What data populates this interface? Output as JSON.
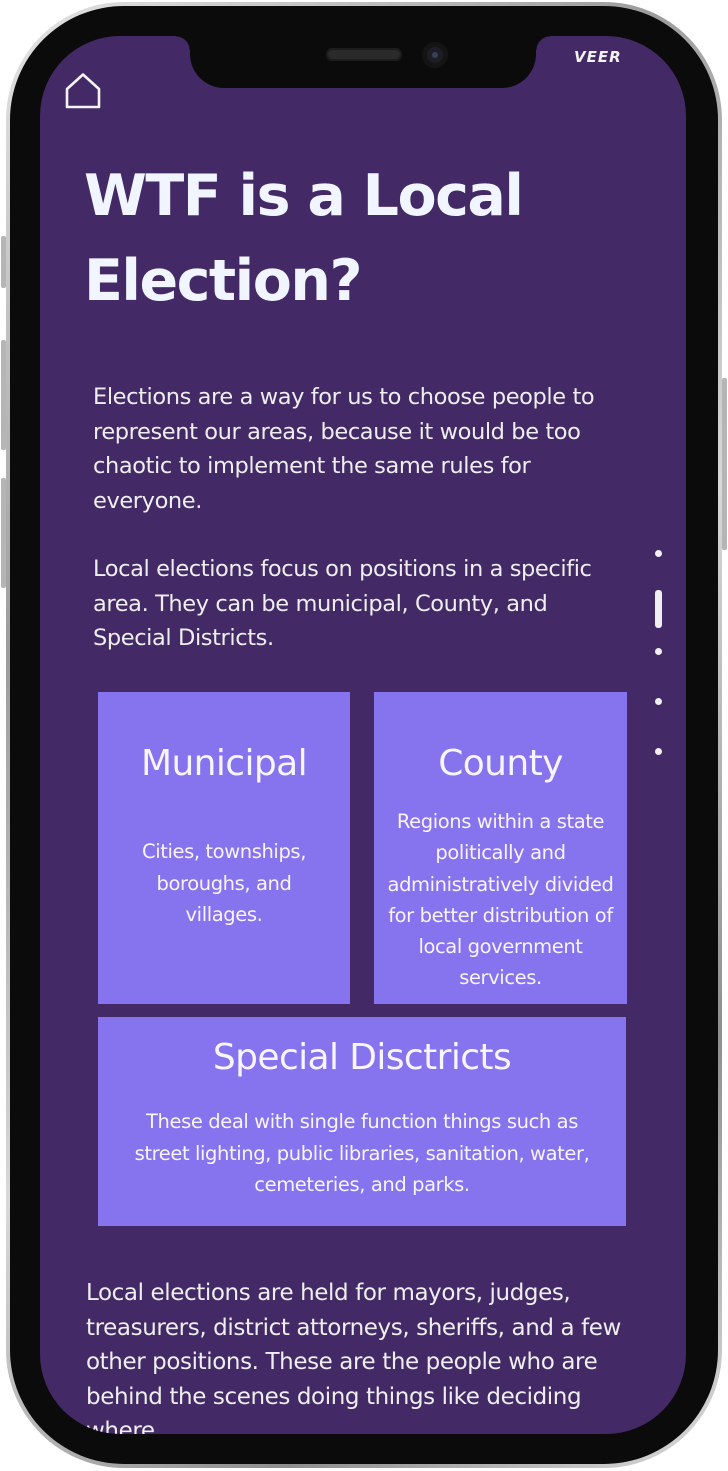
{
  "device": {
    "brand": "VEER"
  },
  "nav": {
    "home_icon": "home-icon"
  },
  "page": {
    "title": "WTF is a Local Election?",
    "intro_paragraph": "Elections are a way for us to choose people to represent our areas, because it would be too chaotic to implement the same rules for everyone.",
    "local_paragraph": "Local elections focus on positions in a specific area. They can be municipal, County, and Special Districts.",
    "positions_paragraph": "Local elections are held for mayors, judges, treasurers, district attorneys, sheriffs, and a few other positions. These are the people who are behind the scenes doing things like deciding where"
  },
  "cards": {
    "municipal": {
      "title": "Municipal",
      "description": "Cities, townships, boroughs, and villages."
    },
    "county": {
      "title": "County",
      "description": "Regions within a state politically and administratively divided for better distribution of local government services."
    },
    "special": {
      "title": "Special Disctricts",
      "description": "These deal with single function things such as street lighting, public libraries, sanitation, water, cemeteries, and parks."
    }
  },
  "pagination": {
    "total": 5,
    "active_index": 2
  },
  "colors": {
    "background": "#432a66",
    "card": "#8673ee",
    "text": "#eeeeee"
  }
}
